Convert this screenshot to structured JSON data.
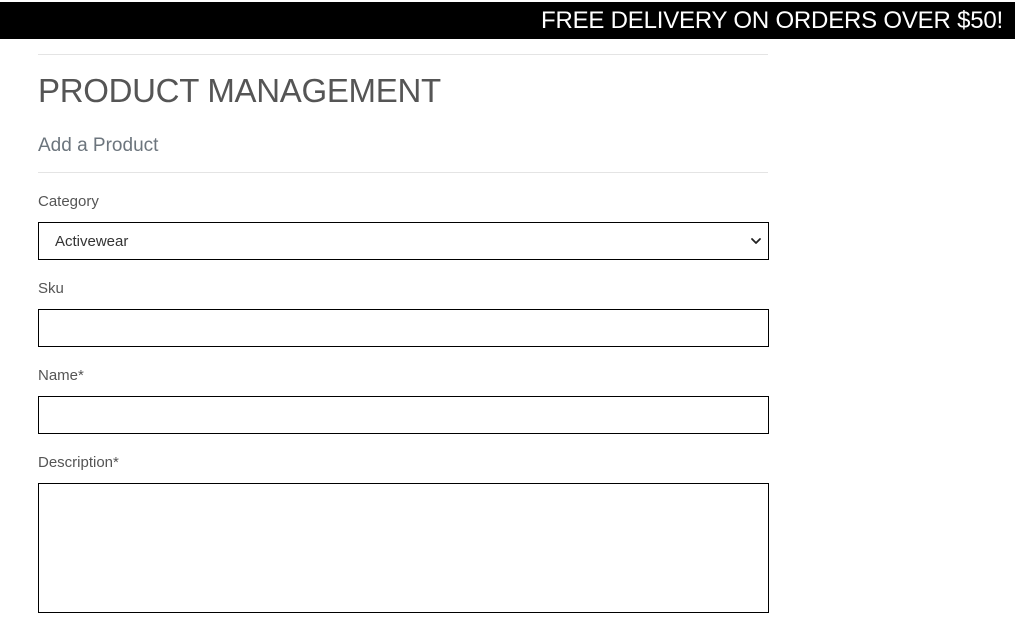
{
  "banner": {
    "text": "FREE DELIVERY ON ORDERS OVER $50!"
  },
  "page": {
    "title": "PRODUCT MANAGEMENT",
    "section_title": "Add a Product"
  },
  "form": {
    "category": {
      "label": "Category",
      "selected": "Activewear",
      "icon": "chevron-down-icon"
    },
    "sku": {
      "label": "Sku",
      "value": ""
    },
    "name": {
      "label": "Name*",
      "value": ""
    },
    "description": {
      "label": "Description*",
      "value": ""
    }
  }
}
